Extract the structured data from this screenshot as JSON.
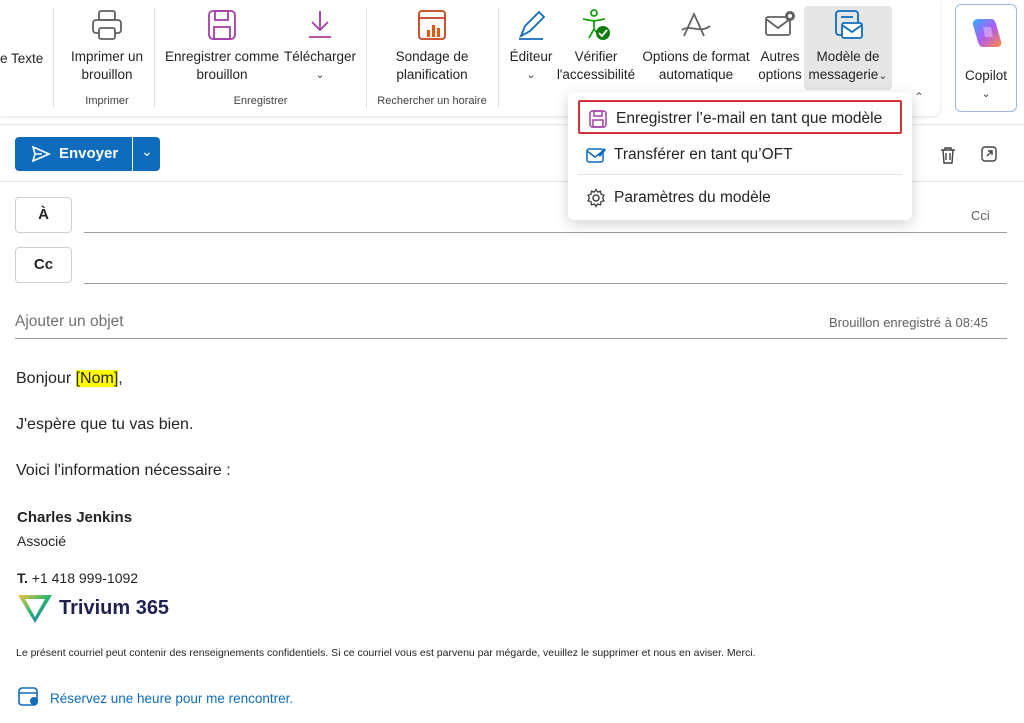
{
  "ribbon": {
    "text_partial": "e Texte",
    "print_draft": "Imprimer un brouillon",
    "print_draft_l1": "Imprimer un",
    "print_draft_l2": "brouillon",
    "group_print": "Imprimer",
    "save_as_draft_l1": "Enregistrer comme",
    "save_as_draft_l2": "brouillon",
    "download": "Télécharger",
    "group_save": "Enregistrer",
    "poll_l1": "Sondage de",
    "poll_l2": "planification",
    "group_find_time": "Rechercher un horaire",
    "editor": "Éditeur",
    "accessibility_l1": "Vérifier",
    "accessibility_l2": "l'accessibilité",
    "format_options_l1": "Options de format",
    "format_options_l2": "automatique",
    "more_options_l1": "Autres",
    "more_options_l2": "options",
    "templates_l1": "Modèle de",
    "templates_l2": "messagerie",
    "copilot": "Copilot"
  },
  "menu": {
    "items": [
      {
        "label": "Enregistrer l’e-mail en tant que modèle",
        "highlighted": true
      },
      {
        "label": "Transférer en tant qu’OFT"
      },
      {
        "label": "Paramètres du modèle"
      }
    ],
    "highlight_color": "#d13438"
  },
  "compose": {
    "send_label": "Envoyer",
    "to_label": "À",
    "cc_label": "Cc",
    "bcc_label": "Cci",
    "subject_placeholder": "Ajouter un objet",
    "draft_status": "Brouillon enregistré à 08:45",
    "accent": "#0f6cbd"
  },
  "body": {
    "greeting_prefix": "Bonjour ",
    "greeting_name": "[Nom]",
    "greeting_suffix": ",",
    "line1": "J'espère que tu vas bien.",
    "line2": "Voici l'information nécessaire :",
    "signature_name": "Charles Jenkins",
    "signature_title": "Associé",
    "phone_label": "T.",
    "phone": "+1 418 999-1092",
    "company": "Trivium 365",
    "disclaimer": "Le présent courriel peut contenir des renseignements confidentiels. Si ce courriel vous est parvenu par mégarde, veuillez le supprimer et nous en aviser. Merci.",
    "booking_link": "Réservez une heure pour me rencontrer."
  }
}
